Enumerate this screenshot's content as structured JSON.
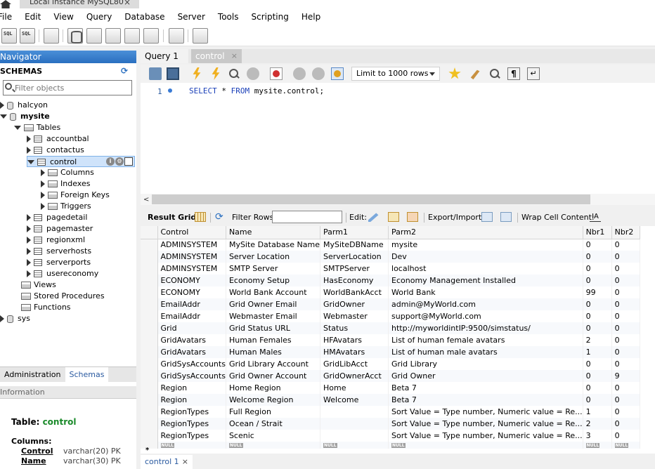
{
  "window": {
    "tab_title": "Local instance MySQL80"
  },
  "menu": [
    "File",
    "Edit",
    "View",
    "Query",
    "Database",
    "Server",
    "Tools",
    "Scripting",
    "Help"
  ],
  "navigator": {
    "header": "Navigator",
    "schemas_label": "SCHEMAS",
    "filter_placeholder": "Filter objects",
    "tree": [
      {
        "label": "halcyon",
        "level": 0,
        "kind": "db",
        "expanded": false
      },
      {
        "label": "mysite",
        "level": 0,
        "kind": "db",
        "expanded": true,
        "bold": true
      },
      {
        "label": "Tables",
        "level": 1,
        "kind": "folder",
        "expanded": true
      },
      {
        "label": "accountbal",
        "level": 2,
        "kind": "table",
        "expanded": false
      },
      {
        "label": "contactus",
        "level": 2,
        "kind": "table",
        "expanded": false
      },
      {
        "label": "control",
        "level": 2,
        "kind": "table",
        "expanded": true,
        "selected": true
      },
      {
        "label": "Columns",
        "level": 3,
        "kind": "folder",
        "expanded": false
      },
      {
        "label": "Indexes",
        "level": 3,
        "kind": "folder",
        "expanded": false
      },
      {
        "label": "Foreign Keys",
        "level": 3,
        "kind": "folder",
        "expanded": false
      },
      {
        "label": "Triggers",
        "level": 3,
        "kind": "folder",
        "expanded": false
      },
      {
        "label": "pagedetail",
        "level": 2,
        "kind": "table",
        "expanded": false
      },
      {
        "label": "pagemaster",
        "level": 2,
        "kind": "table",
        "expanded": false
      },
      {
        "label": "regionxml",
        "level": 2,
        "kind": "table",
        "expanded": false
      },
      {
        "label": "serverhosts",
        "level": 2,
        "kind": "table",
        "expanded": false
      },
      {
        "label": "serverports",
        "level": 2,
        "kind": "table",
        "expanded": false
      },
      {
        "label": "usereconomy",
        "level": 2,
        "kind": "table",
        "expanded": false
      },
      {
        "label": "Views",
        "level": 1,
        "kind": "folder",
        "noarrow": true
      },
      {
        "label": "Stored Procedures",
        "level": 1,
        "kind": "folder",
        "noarrow": true
      },
      {
        "label": "Functions",
        "level": 1,
        "kind": "folder",
        "noarrow": true
      },
      {
        "label": "sys",
        "level": 0,
        "kind": "db",
        "expanded": false
      }
    ],
    "tabs": {
      "administration": "Administration",
      "schemas": "Schemas"
    },
    "info_header": "Information",
    "info": {
      "table_prefix": "Table: ",
      "table_name": "control",
      "columns_label": "Columns:",
      "columns": [
        {
          "name": "Control",
          "type": "varchar(20) PK"
        },
        {
          "name": "Name",
          "type": "varchar(30) PK"
        }
      ]
    }
  },
  "editor": {
    "tabs": [
      {
        "label": "Query 1"
      },
      {
        "label": "control",
        "close": "×"
      }
    ],
    "limit_label": "Limit to 1000 rows",
    "line_number": "1",
    "sql_keyword1": "SELECT",
    "sql_mid": " * ",
    "sql_keyword2": "FROM",
    "sql_rest": " mysite.control;"
  },
  "result_toolbar": {
    "result_grid": "Result Grid",
    "filter_rows": "Filter Rows:",
    "edit": "Edit:",
    "export_import": "Export/Import:",
    "wrap_cell": "Wrap Cell Content:",
    "wrap_icon": "IA"
  },
  "grid": {
    "columns": [
      "Control",
      "Name",
      "Parm1",
      "Parm2",
      "Nbr1",
      "Nbr2"
    ],
    "rows": [
      [
        "ADMINSYSTEM",
        "MySite Database Name",
        "MySiteDBName",
        "mysite",
        "0",
        "0"
      ],
      [
        "ADMINSYSTEM",
        "Server Location",
        "ServerLocation",
        "Dev",
        "0",
        "0"
      ],
      [
        "ADMINSYSTEM",
        "SMTP Server",
        "SMTPServer",
        "localhost",
        "0",
        "0"
      ],
      [
        "ECONOMY",
        "Economy Setup",
        "HasEconomy",
        "Economy Management Installed",
        "0",
        "0"
      ],
      [
        "ECONOMY",
        "World Bank Account",
        "WorldBankAcct",
        "World Bank",
        "99",
        "0"
      ],
      [
        "EmailAddr",
        "Grid Owner Email",
        "GridOwner",
        "admin@MyWorld.com",
        "0",
        "0"
      ],
      [
        "EmailAddr",
        "Webmaster Email",
        "Webmaster",
        "support@MyWorld.com",
        "0",
        "0"
      ],
      [
        "Grid",
        "Grid Status URL",
        "Status",
        "http://myworldintIP:9500/simstatus/",
        "0",
        "0"
      ],
      [
        "GridAvatars",
        "Human Females",
        "HFAvatars",
        "List of human female avatars",
        "2",
        "0"
      ],
      [
        "GridAvatars",
        "Human Males",
        "HMAvatars",
        "List of human male avatars",
        "1",
        "0"
      ],
      [
        "GridSysAccounts",
        "Grid Library Account",
        "GridLibAcct",
        "Grid Library",
        "0",
        "0"
      ],
      [
        "GridSysAccounts",
        "Grid Owner Account",
        "GridOwnerAcct",
        "Grid Owner",
        "0",
        "9"
      ],
      [
        "Region",
        "Home Region",
        "Home",
        "Beta 7",
        "0",
        "0"
      ],
      [
        "Region",
        "Welcome Region",
        "Welcome",
        "Beta 7",
        "0",
        "0"
      ],
      [
        "RegionTypes",
        "Full Region",
        "",
        "Sort Value = Type number, Numeric value = Re...",
        "1",
        "0"
      ],
      [
        "RegionTypes",
        "Ocean / Strait",
        "",
        "Sort Value = Type number, Numeric value = Re...",
        "2",
        "0"
      ],
      [
        "RegionTypes",
        "Scenic",
        "",
        "Sort Value = Type number, Numeric value = Re...",
        "3",
        "0"
      ]
    ],
    "null_label": "NULL",
    "new_row_marker": "*"
  },
  "bottom_tab": {
    "label": "control 1",
    "close": "×"
  }
}
